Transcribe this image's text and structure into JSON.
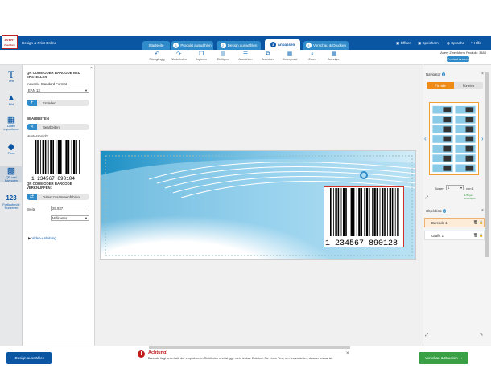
{
  "app": {
    "logo_line1": "AVERY",
    "logo_line2": "Zweckform",
    "title": "Design & Print Online"
  },
  "tabs": [
    {
      "num": "",
      "label": "Startseite"
    },
    {
      "num": "1",
      "label": "Produkt auswählen"
    },
    {
      "num": "2",
      "label": "Design auswählen"
    },
    {
      "num": "3",
      "label": "Anpassen"
    },
    {
      "num": "4",
      "label": "Vorschau & Drucken"
    }
  ],
  "header_links": [
    "Öffnen",
    "Speichern",
    "Sprache",
    "Hilfe"
  ],
  "toolbar": [
    "Rückgängig",
    "Wiederholen",
    "Kopieren",
    "Einfügen",
    "Ausrichten",
    "Anordnen",
    "Hintergrund",
    "Zoom",
    "Anzeigen"
  ],
  "product": {
    "line": "Avery Zweckform Produkt: 3484",
    "change_label": "Produkt ändern"
  },
  "leftnav": [
    "Text",
    "Bild",
    "Daten importieren",
    "Form",
    "QR und Barcodes",
    "Fortlaufende Nummern"
  ],
  "leftnav_glyphs": [
    "T",
    "▲",
    "▦",
    "◆",
    "▩",
    "123"
  ],
  "panel": {
    "heading": "QR CODE ODER BARCODE NEU ERSTELLEN",
    "format_label": "Industrie Standard Format",
    "format_value": "EAN 13",
    "create_label": "Erstellen",
    "edit_heading": "BEARBEITEN",
    "edit_label": "Bearbeiten",
    "preview_label": "Musteransicht",
    "barcode_digits": "1 234567 890104",
    "link_heading": "QR CODE ODER BARCODE VERKNÜPFEN:",
    "merge_label": "Daten zusammenführen",
    "width_label": "Breite",
    "width_value": "25.937",
    "unit_value": "Millimeter",
    "video_label": "Video-Anleitung"
  },
  "canvas": {
    "barcode_digits": "1 234567 890128"
  },
  "right": {
    "navigator_title": "Navigator",
    "seg_all": "Für alle",
    "seg_one": "Für eins",
    "sheet_label": "Bogen",
    "sheet_value": "1",
    "sheet_of": "von 1",
    "add_sheet": "Bogen hinzufügen",
    "objects_title": "Objektliste",
    "objects": [
      "Barcode 1",
      "Grafik 1"
    ]
  },
  "bottom": {
    "back_label": "Design auswählen",
    "alert_title": "Achtung!",
    "alert_text": "Barcode liegt unterhalb der empfohlenen Richtlinien und ist ggf. nicht lesbar. Drücken Sie einen Text, um festzustellen, dass er lesbar ist.",
    "next_label": "Vorschau & Drucken"
  },
  "colors": {
    "brand": "#0b56a3",
    "tab": "#2f8bc9",
    "accent": "#f08a17",
    "success": "#3aa046",
    "alert": "#c21c1c"
  }
}
